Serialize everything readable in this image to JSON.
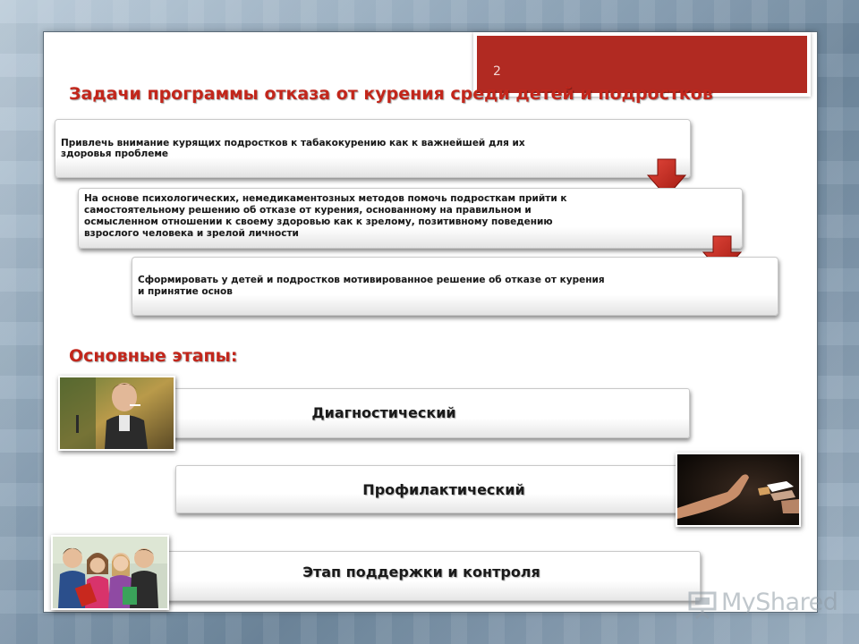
{
  "slide": {
    "page_number": "2",
    "title": "Задачи программы отказа от курения среди детей и подростков",
    "tasks": [
      {
        "lines": [
          "Привлечь внимание курящих подростков  к табакокурению как к важнейшей для их",
          "здоровья проблеме"
        ]
      },
      {
        "lines": [
          "На основе психологических,  немедикаментозных  методов помочь подросткам прийти к",
          "самостоятельному  решению  об отказе от курения, основанному  на правильном  и",
          "осмысленном  отношении к своему здоровью как к зрелому, позитивному поведению",
          "взрослого человека  и зрелой личности"
        ]
      },
      {
        "lines": [
          "Сформировать  у детей и подростков  мотивированное решение  об отказе от курения",
          "и принятие основ"
        ]
      }
    ],
    "stages_heading": "Основные этапы:",
    "stages": [
      {
        "label": "Диагностический",
        "photo_icon": "smoking-teen-photo"
      },
      {
        "label": "Профилактический",
        "photo_icon": "refuse-cigarette-photo"
      },
      {
        "label": "Этап  поддержки и контроля",
        "photo_icon": "teen-group-photo"
      }
    ],
    "watermark": "MyShared",
    "colors": {
      "accent_red": "#c2261b",
      "tab_red": "#b12a22"
    }
  }
}
